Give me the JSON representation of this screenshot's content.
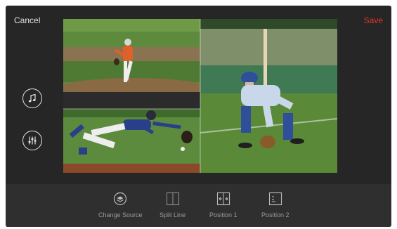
{
  "header": {
    "cancel_label": "Cancel",
    "save_label": "Save"
  },
  "side_controls": [
    {
      "icon": "music-note-icon"
    },
    {
      "icon": "mixer-sliders-icon"
    }
  ],
  "toolbar": {
    "items": [
      {
        "label": "Change Source",
        "icon": "layers-icon"
      },
      {
        "label": "Split Line",
        "icon": "split-line-icon"
      },
      {
        "label": "Position 1",
        "icon": "position-1-icon"
      },
      {
        "label": "Position 2",
        "icon": "position-2-icon"
      }
    ]
  },
  "colors": {
    "background": "#262626",
    "toolbar": "#2f2f2f",
    "save_accent": "#e0352b",
    "text": "#e0e0e0",
    "muted_text": "#9a9a9a"
  }
}
